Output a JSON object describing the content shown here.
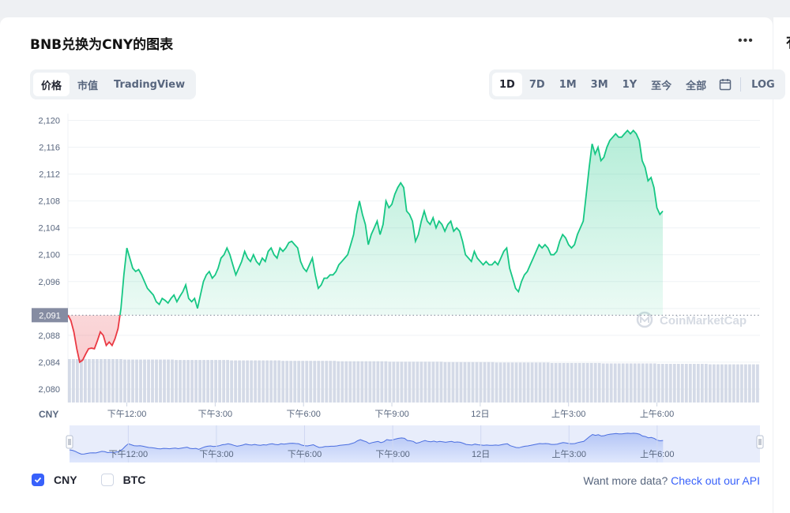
{
  "header": {
    "title": "BNB兑换为CNY的图表",
    "more_label": "•••"
  },
  "view_tabs": [
    {
      "label": "价格",
      "active": true
    },
    {
      "label": "市值",
      "active": false
    },
    {
      "label": "TradingView",
      "active": false
    }
  ],
  "range_tabs": [
    {
      "label": "1D",
      "active": true
    },
    {
      "label": "7D",
      "active": false
    },
    {
      "label": "1M",
      "active": false
    },
    {
      "label": "3M",
      "active": false
    },
    {
      "label": "1Y",
      "active": false
    },
    {
      "label": "至今",
      "active": false
    },
    {
      "label": "全部",
      "active": false
    }
  ],
  "log_label": "LOG",
  "calendar_icon": "calendar-icon",
  "right_column_glyph": "有",
  "legend": [
    {
      "label": "CNY",
      "checked": true
    },
    {
      "label": "BTC",
      "checked": false
    }
  ],
  "api": {
    "prefix": "Want more data?",
    "link": "Check out our API"
  },
  "colors": {
    "up": "#16c784",
    "down": "#ea3943",
    "accent": "#3861fb"
  },
  "chart_data": {
    "type": "line",
    "currency_label": "CNY",
    "watermark": "CoinMarketCap",
    "baseline": 2091,
    "baseline_label": "2,091",
    "ylim": [
      2078,
      2121
    ],
    "y_ticks": [
      2080,
      2084,
      2088,
      2092,
      2096,
      2100,
      2104,
      2108,
      2112,
      2116,
      2120
    ],
    "y_tick_labels": [
      "2,080",
      "2,084",
      "2,088",
      "2,092",
      "2,096",
      "2,100",
      "2,104",
      "2,108",
      "2,112",
      "2,116",
      "2,120"
    ],
    "x_range_hours": [
      10.0,
      33.5
    ],
    "x_ticks": [
      {
        "hour": 12,
        "label": "下午12:00"
      },
      {
        "hour": 15,
        "label": "下午3:00"
      },
      {
        "hour": 18,
        "label": "下午6:00"
      },
      {
        "hour": 21,
        "label": "下午9:00"
      },
      {
        "hour": 24,
        "label": "12日"
      },
      {
        "hour": 27,
        "label": "上午3:00"
      },
      {
        "hour": 30,
        "label": "上午6:00"
      }
    ],
    "grid": true,
    "series": [
      {
        "points": [
          [
            10.0,
            2091.0
          ],
          [
            10.1,
            2090.2
          ],
          [
            10.2,
            2088.5
          ],
          [
            10.3,
            2086.0
          ],
          [
            10.4,
            2084.0
          ],
          [
            10.5,
            2084.3
          ],
          [
            10.6,
            2085.2
          ],
          [
            10.7,
            2086.0
          ],
          [
            10.8,
            2086.1
          ],
          [
            10.9,
            2086.0
          ],
          [
            11.0,
            2087.2
          ],
          [
            11.1,
            2088.5
          ],
          [
            11.2,
            2088.0
          ],
          [
            11.3,
            2086.5
          ],
          [
            11.4,
            2087.0
          ],
          [
            11.5,
            2086.5
          ],
          [
            11.6,
            2087.5
          ],
          [
            11.7,
            2089.0
          ],
          [
            11.8,
            2092.0
          ],
          [
            11.9,
            2097.0
          ],
          [
            12.0,
            2101.0
          ],
          [
            12.1,
            2099.5
          ],
          [
            12.2,
            2098.0
          ],
          [
            12.3,
            2097.5
          ],
          [
            12.4,
            2097.8
          ],
          [
            12.5,
            2097.0
          ],
          [
            12.6,
            2096.0
          ],
          [
            12.7,
            2095.0
          ],
          [
            12.8,
            2094.5
          ],
          [
            12.9,
            2094.0
          ],
          [
            13.0,
            2093.0
          ],
          [
            13.1,
            2092.6
          ],
          [
            13.2,
            2093.5
          ],
          [
            13.3,
            2093.2
          ],
          [
            13.4,
            2092.8
          ],
          [
            13.5,
            2093.5
          ],
          [
            13.6,
            2094.0
          ],
          [
            13.7,
            2093.0
          ],
          [
            13.8,
            2093.8
          ],
          [
            13.9,
            2094.5
          ],
          [
            14.0,
            2095.5
          ],
          [
            14.1,
            2093.5
          ],
          [
            14.2,
            2093.0
          ],
          [
            14.3,
            2093.5
          ],
          [
            14.4,
            2092.0
          ],
          [
            14.5,
            2094.0
          ],
          [
            14.6,
            2096.0
          ],
          [
            14.7,
            2097.0
          ],
          [
            14.8,
            2097.5
          ],
          [
            14.9,
            2096.5
          ],
          [
            15.0,
            2097.0
          ],
          [
            15.1,
            2098.0
          ],
          [
            15.2,
            2099.5
          ],
          [
            15.3,
            2100.0
          ],
          [
            15.4,
            2101.0
          ],
          [
            15.5,
            2100.0
          ],
          [
            15.6,
            2098.5
          ],
          [
            15.7,
            2097.0
          ],
          [
            15.8,
            2098.0
          ],
          [
            15.9,
            2099.0
          ],
          [
            16.0,
            2100.5
          ],
          [
            16.1,
            2099.5
          ],
          [
            16.2,
            2099.0
          ],
          [
            16.3,
            2100.0
          ],
          [
            16.4,
            2099.0
          ],
          [
            16.5,
            2098.5
          ],
          [
            16.6,
            2099.5
          ],
          [
            16.7,
            2099.0
          ],
          [
            16.8,
            2100.5
          ],
          [
            16.9,
            2101.0
          ],
          [
            17.0,
            2100.0
          ],
          [
            17.1,
            2099.5
          ],
          [
            17.2,
            2101.0
          ],
          [
            17.3,
            2100.5
          ],
          [
            17.4,
            2101.0
          ],
          [
            17.5,
            2101.8
          ],
          [
            17.6,
            2102.0
          ],
          [
            17.7,
            2101.5
          ],
          [
            17.8,
            2101.0
          ],
          [
            17.9,
            2099.0
          ],
          [
            18.0,
            2098.0
          ],
          [
            18.1,
            2097.5
          ],
          [
            18.2,
            2098.5
          ],
          [
            18.3,
            2099.5
          ],
          [
            18.4,
            2097.0
          ],
          [
            18.5,
            2095.0
          ],
          [
            18.6,
            2095.5
          ],
          [
            18.7,
            2096.5
          ],
          [
            18.8,
            2096.5
          ],
          [
            18.9,
            2097.0
          ],
          [
            19.0,
            2097.0
          ],
          [
            19.1,
            2097.5
          ],
          [
            19.2,
            2098.5
          ],
          [
            19.3,
            2099.0
          ],
          [
            19.4,
            2099.5
          ],
          [
            19.5,
            2100.0
          ],
          [
            19.6,
            2101.5
          ],
          [
            19.7,
            2103.0
          ],
          [
            19.8,
            2106.0
          ],
          [
            19.9,
            2108.0
          ],
          [
            20.0,
            2106.0
          ],
          [
            20.1,
            2104.5
          ],
          [
            20.2,
            2101.5
          ],
          [
            20.3,
            2103.0
          ],
          [
            20.4,
            2104.0
          ],
          [
            20.5,
            2105.0
          ],
          [
            20.6,
            2103.0
          ],
          [
            20.7,
            2104.5
          ],
          [
            20.8,
            2108.0
          ],
          [
            20.9,
            2107.0
          ],
          [
            21.0,
            2107.5
          ],
          [
            21.1,
            2109.0
          ],
          [
            21.2,
            2110.0
          ],
          [
            21.3,
            2110.7
          ],
          [
            21.4,
            2110.0
          ],
          [
            21.5,
            2106.5
          ],
          [
            21.6,
            2106.0
          ],
          [
            21.7,
            2105.0
          ],
          [
            21.8,
            2102.0
          ],
          [
            21.9,
            2103.0
          ],
          [
            22.0,
            2105.0
          ],
          [
            22.1,
            2106.5
          ],
          [
            22.2,
            2105.0
          ],
          [
            22.3,
            2104.5
          ],
          [
            22.4,
            2105.5
          ],
          [
            22.5,
            2104.0
          ],
          [
            22.6,
            2105.0
          ],
          [
            22.7,
            2104.5
          ],
          [
            22.8,
            2103.5
          ],
          [
            22.9,
            2104.5
          ],
          [
            23.0,
            2105.0
          ],
          [
            23.1,
            2103.5
          ],
          [
            23.2,
            2104.0
          ],
          [
            23.3,
            2103.5
          ],
          [
            23.4,
            2102.0
          ],
          [
            23.5,
            2100.0
          ],
          [
            23.6,
            2099.5
          ],
          [
            23.7,
            2099.0
          ],
          [
            23.8,
            2100.5
          ],
          [
            23.9,
            2099.5
          ],
          [
            24.0,
            2099.0
          ],
          [
            24.1,
            2098.5
          ],
          [
            24.2,
            2099.0
          ],
          [
            24.3,
            2098.5
          ],
          [
            24.4,
            2098.5
          ],
          [
            24.5,
            2099.0
          ],
          [
            24.6,
            2098.5
          ],
          [
            24.7,
            2099.5
          ],
          [
            24.8,
            2100.5
          ],
          [
            24.9,
            2101.0
          ],
          [
            25.0,
            2098.0
          ],
          [
            25.1,
            2096.5
          ],
          [
            25.2,
            2095.0
          ],
          [
            25.3,
            2094.5
          ],
          [
            25.4,
            2096.0
          ],
          [
            25.5,
            2097.0
          ],
          [
            25.6,
            2097.5
          ],
          [
            25.7,
            2098.5
          ],
          [
            25.8,
            2099.5
          ],
          [
            25.9,
            2100.5
          ],
          [
            26.0,
            2101.5
          ],
          [
            26.1,
            2101.0
          ],
          [
            26.2,
            2101.5
          ],
          [
            26.3,
            2101.0
          ],
          [
            26.4,
            2100.0
          ],
          [
            26.5,
            2100.0
          ],
          [
            26.6,
            2100.5
          ],
          [
            26.7,
            2102.0
          ],
          [
            26.8,
            2103.0
          ],
          [
            26.9,
            2102.5
          ],
          [
            27.0,
            2101.5
          ],
          [
            27.1,
            2101.0
          ],
          [
            27.2,
            2101.5
          ],
          [
            27.3,
            2103.0
          ],
          [
            27.4,
            2104.0
          ],
          [
            27.5,
            2105.0
          ],
          [
            27.6,
            2109.0
          ],
          [
            27.7,
            2113.0
          ],
          [
            27.8,
            2116.5
          ],
          [
            27.9,
            2115.0
          ],
          [
            28.0,
            2116.0
          ],
          [
            28.1,
            2114.0
          ],
          [
            28.2,
            2114.5
          ],
          [
            28.3,
            2116.0
          ],
          [
            28.4,
            2117.0
          ],
          [
            28.5,
            2117.5
          ],
          [
            28.6,
            2118.0
          ],
          [
            28.7,
            2117.5
          ],
          [
            28.8,
            2117.5
          ],
          [
            28.9,
            2118.0
          ],
          [
            29.0,
            2118.5
          ],
          [
            29.1,
            2118.0
          ],
          [
            29.2,
            2118.5
          ],
          [
            29.3,
            2118.0
          ],
          [
            29.4,
            2117.0
          ],
          [
            29.5,
            2114.0
          ],
          [
            29.6,
            2113.0
          ],
          [
            29.7,
            2111.0
          ],
          [
            29.8,
            2111.5
          ],
          [
            29.9,
            2110.0
          ],
          [
            30.0,
            2107.0
          ],
          [
            30.1,
            2106.0
          ],
          [
            30.2,
            2106.5
          ]
        ]
      }
    ],
    "volume": {
      "label": "volume",
      "relative_levels": [
        1.0,
        0.99,
        0.98,
        0.97,
        0.96,
        0.95,
        0.94,
        0.93,
        0.92,
        0.91,
        0.9,
        0.89,
        0.88
      ]
    }
  }
}
